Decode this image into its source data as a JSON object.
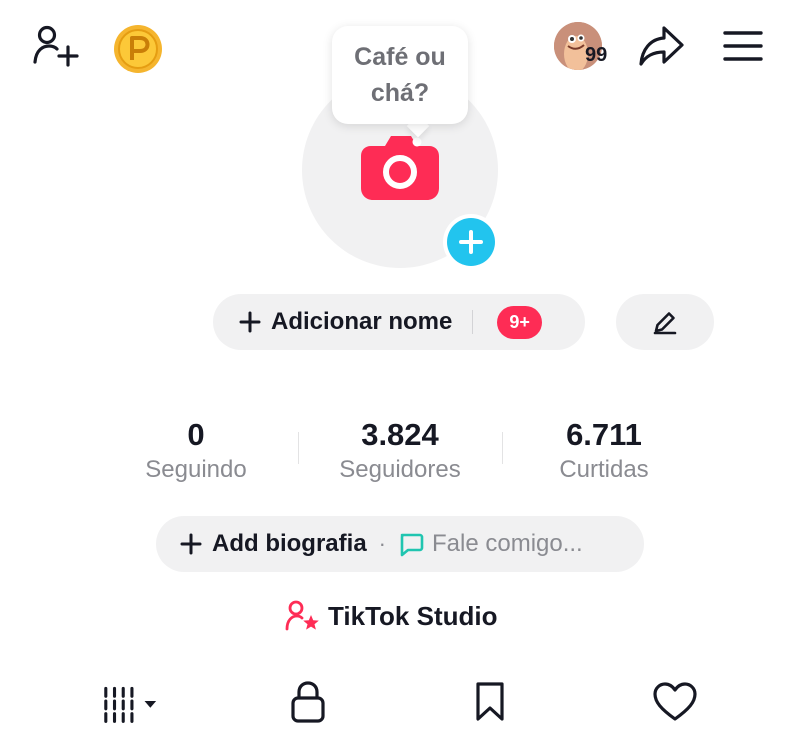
{
  "tooltip": {
    "text": "Café ou chá?"
  },
  "streak": {
    "count": "99"
  },
  "profile": {
    "add_name_label": "Adicionar nome",
    "notification_badge": "9+"
  },
  "stats": [
    {
      "value": "0",
      "label": "Seguindo"
    },
    {
      "value": "3.824",
      "label": "Seguidores"
    },
    {
      "value": "6.711",
      "label": "Curtidas"
    }
  ],
  "bio": {
    "add_label": "Add biografia",
    "separator": "·",
    "chat_label": "Fale comigo..."
  },
  "studio": {
    "label": "TikTok Studio"
  },
  "tabs": [
    {
      "name": "videos",
      "icon": "grid-bars-icon",
      "active": true
    },
    {
      "name": "private",
      "icon": "lock-icon"
    },
    {
      "name": "saved",
      "icon": "bookmark-icon"
    },
    {
      "name": "liked",
      "icon": "heart-icon"
    }
  ],
  "colors": {
    "accent_red": "#fe2c55",
    "accent_cyan": "#22c4ee",
    "coin_gold": "#f5b52e",
    "chat_teal": "#20c5b0",
    "pill_bg": "#f1f1f2"
  },
  "icons": {
    "add_friend": "add-friend-icon",
    "coin": "coin-icon",
    "share": "share-icon",
    "menu": "menu-icon",
    "camera": "camera-icon",
    "edit": "pencil-icon",
    "studio": "studio-icon"
  }
}
